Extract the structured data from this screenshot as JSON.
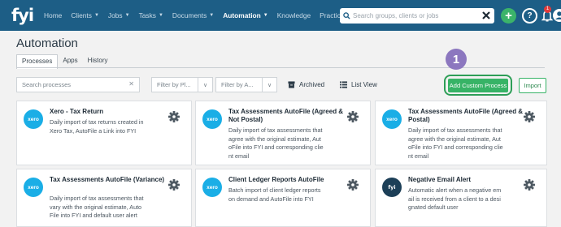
{
  "nav": {
    "logo": "fyi",
    "items": [
      {
        "label": "Home",
        "caret": false,
        "active": false
      },
      {
        "label": "Clients",
        "caret": true,
        "active": false
      },
      {
        "label": "Jobs",
        "caret": true,
        "active": false
      },
      {
        "label": "Tasks",
        "caret": true,
        "active": false
      },
      {
        "label": "Documents",
        "caret": true,
        "active": false
      },
      {
        "label": "Automation",
        "caret": true,
        "active": true
      },
      {
        "label": "Knowledge",
        "caret": false,
        "active": false
      },
      {
        "label": "Practice",
        "caret": false,
        "active": false
      }
    ],
    "search_placeholder": "Search groups, clients or jobs",
    "notification_count": "1"
  },
  "page": {
    "title": "Automation",
    "tabs": [
      {
        "label": "Processes",
        "active": true
      },
      {
        "label": "Apps",
        "active": false
      },
      {
        "label": "History",
        "active": false
      }
    ]
  },
  "filters": {
    "search_placeholder": "Search processes",
    "filter1": "Filter by Pl...",
    "filter2": "Filter by A...",
    "archived": "Archived",
    "list_view": "List View",
    "add_button": "Add Custom Process",
    "import_button": "Import",
    "step_number": "1"
  },
  "cards": [
    {
      "logo": "xero",
      "title": "Xero - Tax Return",
      "desc": [
        "Daily import of tax returns created in",
        "Xero Tax, AutoFile a Link into FYI"
      ]
    },
    {
      "logo": "xero",
      "title": "Tax Assessments AutoFile (Agreed & Not Postal)",
      "desc": [
        "Daily import of tax assessments that",
        "agree with the original estimate, Aut",
        "oFile into FYI and corresponding clie",
        "nt email"
      ]
    },
    {
      "logo": "xero",
      "title": "Tax Assessments AutoFile (Agreed & Postal)",
      "desc": [
        "Daily import of tax assessments that",
        "agree with the original estimate, Aut",
        "oFile into FYI and corresponding clie",
        "nt email"
      ]
    },
    {
      "logo": "xero",
      "title": "Tax Assessments AutoFile (Variance)",
      "desc": [
        "Daily import of tax assessments that",
        "vary with the original estimate, Auto",
        "File into FYI and default user alert"
      ]
    },
    {
      "logo": "xero",
      "title": "Client Ledger Reports AutoFile",
      "desc": [
        "Batch import of client ledger reports",
        "on demand and AutoFile into FYI"
      ]
    },
    {
      "logo": "fyi",
      "title": "Negative Email Alert",
      "desc": [
        "Automatic alert when a negative em",
        "ail is received from a client to a desi",
        "gnated default user"
      ]
    }
  ],
  "colors": {
    "nav_bg": "#1d5e86",
    "accent_green": "#37b366",
    "xero_blue": "#1aaee6",
    "step_purple": "#8c77bf"
  }
}
